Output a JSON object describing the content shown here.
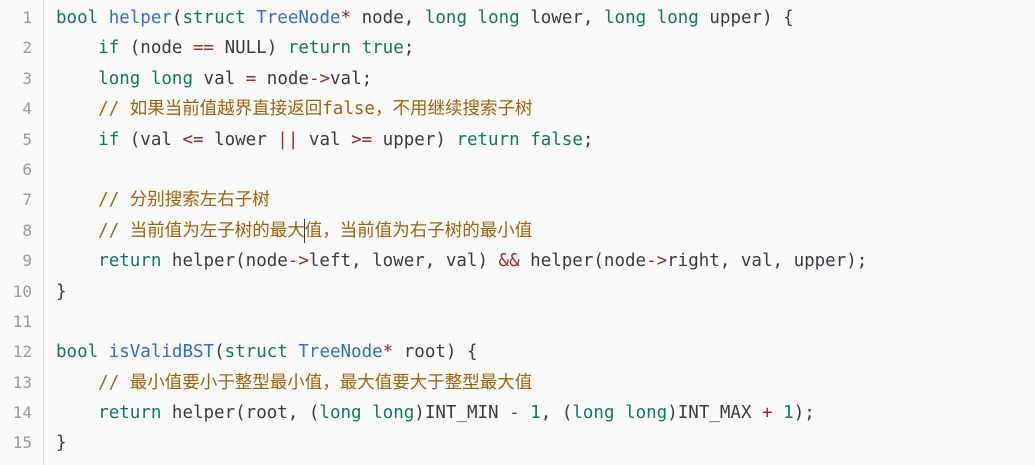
{
  "line_numbers": [
    "1",
    "2",
    "3",
    "4",
    "5",
    "6",
    "7",
    "8",
    "9",
    "10",
    "11",
    "12",
    "13",
    "14",
    "15"
  ],
  "colors": {
    "background": "#fafafa",
    "keyword": "#0e7a55",
    "function": "#2f6bd1",
    "operator": "#a0281d",
    "comment": "#a0620a",
    "text": "#383a42"
  },
  "lines": [
    [
      {
        "t": "kw",
        "v": "bool"
      },
      {
        "t": "plain",
        "v": " "
      },
      {
        "t": "fn",
        "v": "helper"
      },
      {
        "t": "plain",
        "v": "("
      },
      {
        "t": "kw",
        "v": "struct"
      },
      {
        "t": "plain",
        "v": " "
      },
      {
        "t": "fn",
        "v": "TreeNode"
      },
      {
        "t": "op",
        "v": "*"
      },
      {
        "t": "plain",
        "v": " node, "
      },
      {
        "t": "kw",
        "v": "long"
      },
      {
        "t": "plain",
        "v": " "
      },
      {
        "t": "kw",
        "v": "long"
      },
      {
        "t": "plain",
        "v": " lower, "
      },
      {
        "t": "kw",
        "v": "long"
      },
      {
        "t": "plain",
        "v": " "
      },
      {
        "t": "kw",
        "v": "long"
      },
      {
        "t": "plain",
        "v": " upper) {"
      }
    ],
    [
      {
        "t": "plain",
        "v": "    "
      },
      {
        "t": "kw",
        "v": "if"
      },
      {
        "t": "plain",
        "v": " (node "
      },
      {
        "t": "op",
        "v": "=="
      },
      {
        "t": "plain",
        "v": " NULL) "
      },
      {
        "t": "kw",
        "v": "return"
      },
      {
        "t": "plain",
        "v": " "
      },
      {
        "t": "kw",
        "v": "true"
      },
      {
        "t": "plain",
        "v": ";"
      }
    ],
    [
      {
        "t": "plain",
        "v": "    "
      },
      {
        "t": "kw",
        "v": "long"
      },
      {
        "t": "plain",
        "v": " "
      },
      {
        "t": "kw",
        "v": "long"
      },
      {
        "t": "plain",
        "v": " val "
      },
      {
        "t": "op",
        "v": "="
      },
      {
        "t": "plain",
        "v": " node"
      },
      {
        "t": "op",
        "v": "->"
      },
      {
        "t": "plain",
        "v": "val;"
      }
    ],
    [
      {
        "t": "plain",
        "v": "    "
      },
      {
        "t": "cm",
        "v": "// 如果当前值越界直接返回false，不用继续搜索子树"
      }
    ],
    [
      {
        "t": "plain",
        "v": "    "
      },
      {
        "t": "kw",
        "v": "if"
      },
      {
        "t": "plain",
        "v": " (val "
      },
      {
        "t": "op",
        "v": "<="
      },
      {
        "t": "plain",
        "v": " lower "
      },
      {
        "t": "op",
        "v": "||"
      },
      {
        "t": "plain",
        "v": " val "
      },
      {
        "t": "op",
        "v": ">="
      },
      {
        "t": "plain",
        "v": " upper) "
      },
      {
        "t": "kw",
        "v": "return"
      },
      {
        "t": "plain",
        "v": " "
      },
      {
        "t": "kw",
        "v": "false"
      },
      {
        "t": "plain",
        "v": ";"
      }
    ],
    [],
    [
      {
        "t": "plain",
        "v": "    "
      },
      {
        "t": "cm",
        "v": "// 分别搜索左右子树"
      }
    ],
    [
      {
        "t": "plain",
        "v": "    "
      },
      {
        "t": "cm",
        "v": "// 当前值为左子树的最大"
      },
      {
        "t": "caret",
        "v": ""
      },
      {
        "t": "cm",
        "v": "值，当前值为右子树的最小值"
      }
    ],
    [
      {
        "t": "plain",
        "v": "    "
      },
      {
        "t": "kw",
        "v": "return"
      },
      {
        "t": "plain",
        "v": " helper(node"
      },
      {
        "t": "op",
        "v": "->"
      },
      {
        "t": "plain",
        "v": "left, lower, val) "
      },
      {
        "t": "op",
        "v": "&&"
      },
      {
        "t": "plain",
        "v": " helper(node"
      },
      {
        "t": "op",
        "v": "->"
      },
      {
        "t": "plain",
        "v": "right, val, upper);"
      }
    ],
    [
      {
        "t": "plain",
        "v": "}"
      }
    ],
    [],
    [
      {
        "t": "kw",
        "v": "bool"
      },
      {
        "t": "plain",
        "v": " "
      },
      {
        "t": "fn",
        "v": "isValidBST"
      },
      {
        "t": "plain",
        "v": "("
      },
      {
        "t": "kw",
        "v": "struct"
      },
      {
        "t": "plain",
        "v": " "
      },
      {
        "t": "fn",
        "v": "TreeNode"
      },
      {
        "t": "op",
        "v": "*"
      },
      {
        "t": "plain",
        "v": " root) {"
      }
    ],
    [
      {
        "t": "plain",
        "v": "    "
      },
      {
        "t": "cm",
        "v": "// 最小值要小于整型最小值，最大值要大于整型最大值"
      }
    ],
    [
      {
        "t": "plain",
        "v": "    "
      },
      {
        "t": "kw",
        "v": "return"
      },
      {
        "t": "plain",
        "v": " helper(root, ("
      },
      {
        "t": "kw",
        "v": "long"
      },
      {
        "t": "plain",
        "v": " "
      },
      {
        "t": "kw",
        "v": "long"
      },
      {
        "t": "plain",
        "v": ")INT_MIN "
      },
      {
        "t": "op",
        "v": "-"
      },
      {
        "t": "plain",
        "v": " "
      },
      {
        "t": "num",
        "v": "1"
      },
      {
        "t": "plain",
        "v": ", ("
      },
      {
        "t": "kw",
        "v": "long"
      },
      {
        "t": "plain",
        "v": " "
      },
      {
        "t": "kw",
        "v": "long"
      },
      {
        "t": "plain",
        "v": ")INT_MAX "
      },
      {
        "t": "op",
        "v": "+"
      },
      {
        "t": "plain",
        "v": " "
      },
      {
        "t": "num",
        "v": "1"
      },
      {
        "t": "plain",
        "v": ");"
      }
    ],
    [
      {
        "t": "plain",
        "v": "}"
      }
    ]
  ]
}
